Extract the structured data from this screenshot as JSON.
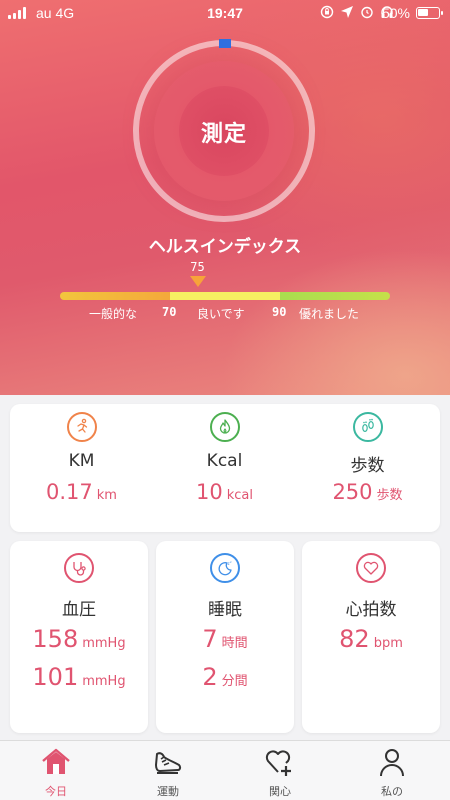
{
  "status_bar": {
    "carrier": "au 4G",
    "time": "19:47",
    "battery_percent": "50%",
    "battery_level": 0.5,
    "icons": [
      "signal-icon",
      "rotation-lock-icon",
      "location-icon",
      "alarm-icon",
      "headphones-icon",
      "battery-icon"
    ]
  },
  "hero": {
    "measure_label": "測定",
    "index_title": "ヘルスインデックス",
    "score": "75",
    "score_value": 75,
    "scale": {
      "labels": [
        "一般的な",
        "良いです",
        "優れました"
      ],
      "thresholds": [
        "70",
        "90"
      ],
      "colors": [
        "#f4b23b",
        "#f6ef62",
        "#b5df4c"
      ]
    }
  },
  "summary": {
    "distance": {
      "label": "KM",
      "value": "0.17",
      "unit": "km",
      "icon": "running-icon",
      "color": "#f0834a"
    },
    "calories": {
      "label": "Kcal",
      "value": "10",
      "unit": "kcal",
      "icon": "flame-icon",
      "color": "#4caf50"
    },
    "steps": {
      "label": "歩数",
      "value": "250",
      "unit": "歩数",
      "icon": "footprints-icon",
      "color": "#3bb8a0"
    }
  },
  "blood_pressure": {
    "label": "血圧",
    "systolic": "158",
    "diastolic": "101",
    "unit": "mmHg",
    "icon": "stethoscope-icon",
    "color": "#e05470"
  },
  "sleep": {
    "label": "睡眠",
    "hours": "7",
    "hours_unit": "時間",
    "minutes": "2",
    "minutes_unit": "分間",
    "icon": "moon-icon",
    "color": "#3f8fe8"
  },
  "heart_rate": {
    "label": "心拍数",
    "value": "82",
    "unit": "bpm",
    "icon": "heart-icon",
    "color": "#e05470"
  },
  "tabs": [
    {
      "label": "今日",
      "icon": "home-icon",
      "active": true
    },
    {
      "label": "運動",
      "icon": "shoe-icon",
      "active": false
    },
    {
      "label": "関心",
      "icon": "heart-plus-icon",
      "active": false
    },
    {
      "label": "私の",
      "icon": "person-icon",
      "active": false
    }
  ],
  "accent_color": "#e05470"
}
